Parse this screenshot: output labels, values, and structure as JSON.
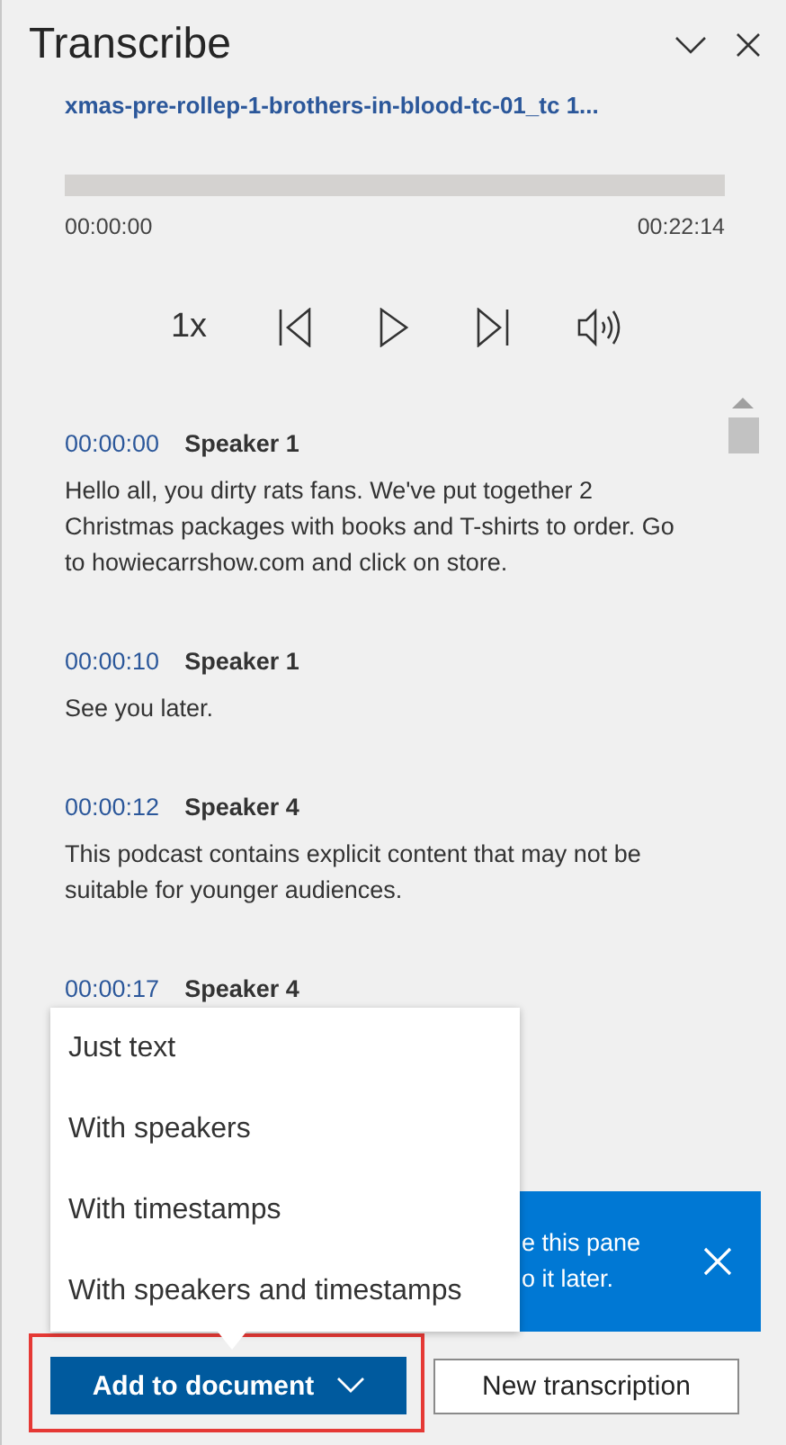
{
  "pane": {
    "title": "Transcribe"
  },
  "file": {
    "name": "xmas-pre-rollep-1-brothers-in-blood-tc-01_tc 1..."
  },
  "player": {
    "level": 0,
    "start": "00:00:00",
    "end": "00:22:14",
    "speed": "1x"
  },
  "transcript": [
    {
      "time": "00:00:00",
      "speaker": "Speaker 1",
      "text": "Hello all, you dirty rats fans. We've put together 2 Christmas packages with books and T-shirts to order. Go to howiecarrshow.com and click on store."
    },
    {
      "time": "00:00:10",
      "speaker": "Speaker 1",
      "text": "See you later."
    },
    {
      "time": "00:00:12",
      "speaker": "Speaker 4",
      "text": "This podcast contains explicit content that may not be suitable for younger audiences."
    },
    {
      "time": "00:00:17",
      "speaker": "Speaker 4"
    }
  ],
  "notification": {
    "lines": [
      "e this pane",
      "o it later."
    ]
  },
  "add_menu": {
    "items": [
      "Just text",
      "With speakers",
      "With timestamps",
      "With speakers and timestamps"
    ]
  },
  "buttons": {
    "primary": "Add to document",
    "secondary": "New transcription"
  }
}
